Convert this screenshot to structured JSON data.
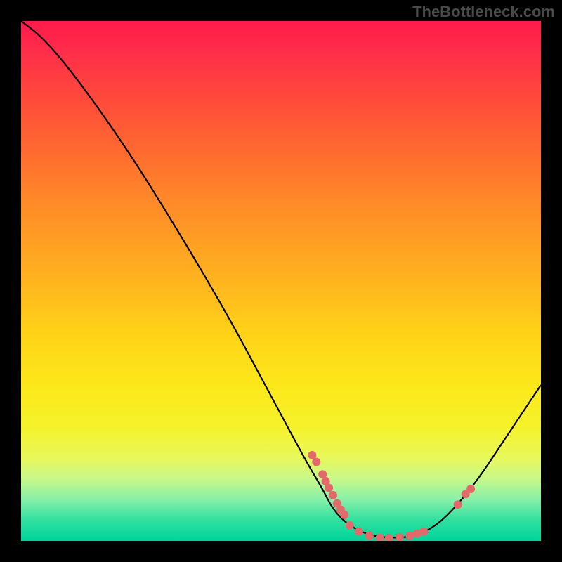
{
  "watermark": "TheBottleneck.com",
  "chart_data": {
    "type": "line",
    "title": "",
    "xlabel": "",
    "ylabel": "",
    "xlim": [
      0,
      100
    ],
    "ylim": [
      0,
      100
    ],
    "grid": false,
    "curve": {
      "name": "bottleneck-curve",
      "points_norm": [
        [
          0.0,
          1.0
        ],
        [
          0.04,
          0.97
        ],
        [
          0.1,
          0.9
        ],
        [
          0.2,
          0.76
        ],
        [
          0.3,
          0.6
        ],
        [
          0.4,
          0.43
        ],
        [
          0.48,
          0.28
        ],
        [
          0.55,
          0.15
        ],
        [
          0.58,
          0.1
        ],
        [
          0.6,
          0.06
        ],
        [
          0.63,
          0.03
        ],
        [
          0.67,
          0.01
        ],
        [
          0.72,
          0.005
        ],
        [
          0.76,
          0.01
        ],
        [
          0.8,
          0.03
        ],
        [
          0.84,
          0.07
        ],
        [
          0.88,
          0.12
        ],
        [
          0.92,
          0.18
        ],
        [
          0.96,
          0.24
        ],
        [
          1.0,
          0.3
        ]
      ]
    },
    "marker_clusters_norm": [
      {
        "x": 0.56,
        "y": 0.165
      },
      {
        "x": 0.568,
        "y": 0.152
      },
      {
        "x": 0.58,
        "y": 0.128
      },
      {
        "x": 0.586,
        "y": 0.115
      },
      {
        "x": 0.592,
        "y": 0.102
      },
      {
        "x": 0.6,
        "y": 0.088
      },
      {
        "x": 0.608,
        "y": 0.072
      },
      {
        "x": 0.615,
        "y": 0.06
      },
      {
        "x": 0.622,
        "y": 0.05
      },
      {
        "x": 0.632,
        "y": 0.03
      },
      {
        "x": 0.65,
        "y": 0.018
      },
      {
        "x": 0.67,
        "y": 0.01
      },
      {
        "x": 0.69,
        "y": 0.006
      },
      {
        "x": 0.708,
        "y": 0.005
      },
      {
        "x": 0.728,
        "y": 0.007
      },
      {
        "x": 0.748,
        "y": 0.01
      },
      {
        "x": 0.762,
        "y": 0.014
      },
      {
        "x": 0.775,
        "y": 0.018
      },
      {
        "x": 0.84,
        "y": 0.07
      },
      {
        "x": 0.855,
        "y": 0.09
      },
      {
        "x": 0.865,
        "y": 0.1
      }
    ],
    "colors": {
      "curve": "#000000",
      "marker": "#e36a6a",
      "gradient_top": "#ff1a4a",
      "gradient_bottom": "#00d49a",
      "background": "#000000"
    }
  }
}
